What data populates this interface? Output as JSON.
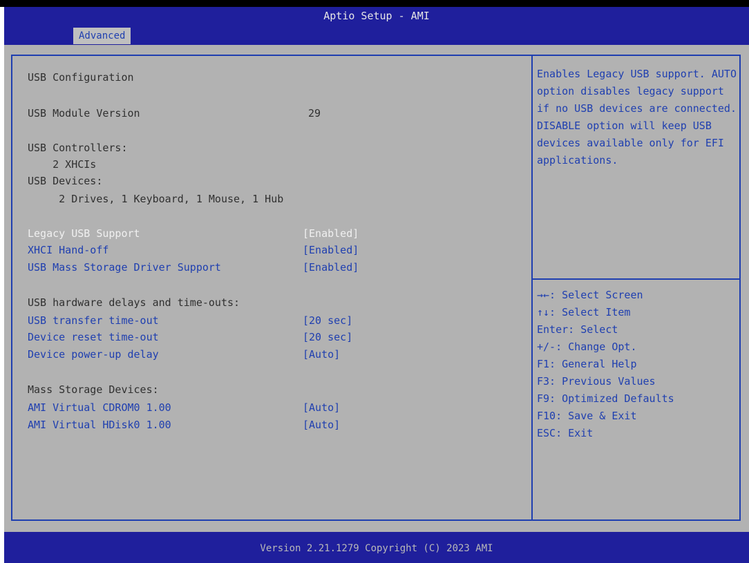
{
  "header": {
    "title": "Aptio Setup - AMI",
    "tab": "Advanced"
  },
  "main": {
    "rows": [
      {
        "label": "USB Configuration",
        "value": "",
        "style": "normal"
      },
      {
        "label": "USB Module Version",
        "value": "29",
        "style": "normal"
      },
      {
        "label": "USB Controllers:",
        "value": "",
        "style": "normal"
      },
      {
        "label": "    2 XHCIs",
        "value": "",
        "style": "normal"
      },
      {
        "label": "USB Devices:",
        "value": "",
        "style": "normal"
      },
      {
        "label": "     2 Drives, 1 Keyboard, 1 Mouse, 1 Hub",
        "value": "",
        "style": "normal"
      },
      {
        "label": "Legacy USB Support",
        "value": "[Enabled]",
        "style": "selected"
      },
      {
        "label": "XHCI Hand-off",
        "value": "[Enabled]",
        "style": "link"
      },
      {
        "label": "USB Mass Storage Driver Support",
        "value": "[Enabled]",
        "style": "link"
      },
      {
        "label": "USB hardware delays and time-outs:",
        "value": "",
        "style": "normal"
      },
      {
        "label": "USB transfer time-out",
        "value": "[20 sec]",
        "style": "link"
      },
      {
        "label": "Device reset time-out",
        "value": "[20 sec]",
        "style": "link"
      },
      {
        "label": "Device power-up delay",
        "value": "[Auto]",
        "style": "link"
      },
      {
        "label": "Mass Storage Devices:",
        "value": "",
        "style": "normal"
      },
      {
        "label": "AMI Virtual CDROM0 1.00",
        "value": "[Auto]",
        "style": "link"
      },
      {
        "label": "AMI Virtual HDisk0 1.00",
        "value": "[Auto]",
        "style": "link"
      }
    ]
  },
  "help": {
    "text": "Enables Legacy USB support. AUTO option disables legacy support if no USB devices are connected. DISABLE option will keep USB devices available only for EFI applications."
  },
  "keys": [
    "→←: Select Screen",
    "↑↓: Select Item",
    "Enter: Select",
    "+/-: Change Opt.",
    "F1: General Help",
    "F3: Previous Values",
    "F9: Optimized Defaults",
    "F10: Save & Exit",
    "ESC: Exit"
  ],
  "footer": {
    "version": "Version 2.21.1279 Copyright (C) 2023 AMI"
  },
  "colors": {
    "header_bg": "#1f1f9c",
    "panel_bg": "#b2b2b2",
    "link_text": "#1f3fb0",
    "selected_text": "#f0f0f0"
  }
}
